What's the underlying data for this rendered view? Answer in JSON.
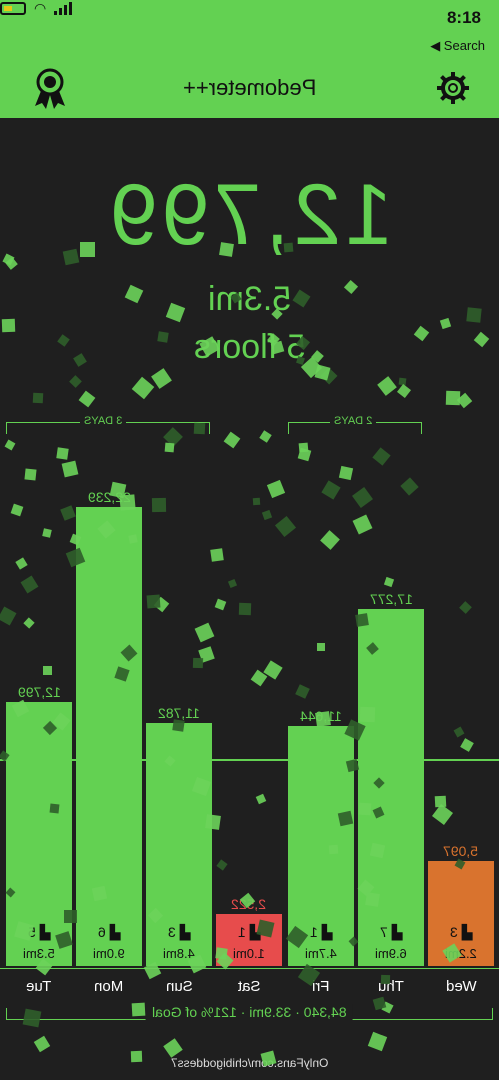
{
  "status": {
    "time": "8:18",
    "back_label": "◀ Search",
    "wifi_icon": "wifi-icon",
    "battery_icon": "battery-icon",
    "signal_icon": "signal-icon"
  },
  "header": {
    "title": "Pedometer++",
    "left_icon": "award-ribbon-icon",
    "right_icon": "gear-icon"
  },
  "today": {
    "steps": "12,799",
    "distance": "5.3mi",
    "floors": "5 floors"
  },
  "chart": {
    "brackets": [
      {
        "label": "3 DAYS"
      },
      {
        "label": "2 DAYS"
      }
    ],
    "summary": "84,340 · 33.9mi · 121% of Goal",
    "watermark": "OnlyFans.com/chibigoddess7",
    "colors": {
      "green": "#63d152",
      "red": "#e74c4c",
      "orange": "#d9732e",
      "background": "#1f1f1f"
    }
  },
  "chart_data": {
    "type": "bar",
    "categories": [
      "Tue",
      "Mon",
      "Sun",
      "Sat",
      "Fri",
      "Thu",
      "Wed"
    ],
    "values": [
      12799,
      22239,
      11782,
      2522,
      11644,
      17277,
      5097
    ],
    "value_labels": [
      "12,799",
      "22,239",
      "11,782",
      "2,522",
      "11,644",
      "17,277",
      "5,097"
    ],
    "distance_labels": [
      "5.3mi",
      "9.0mi",
      "4.8mi",
      "1.0mi",
      "4.7mi",
      "6.9mi",
      "2.2mi"
    ],
    "floors_labels": [
      "5",
      "6",
      "3",
      "1",
      "1",
      "7",
      "3"
    ],
    "bar_colors": [
      "#63d152",
      "#63d152",
      "#63d152",
      "#e74c4c",
      "#63d152",
      "#63d152",
      "#d9732e"
    ],
    "ylim": [
      0,
      24500
    ],
    "goal": 10000
  }
}
